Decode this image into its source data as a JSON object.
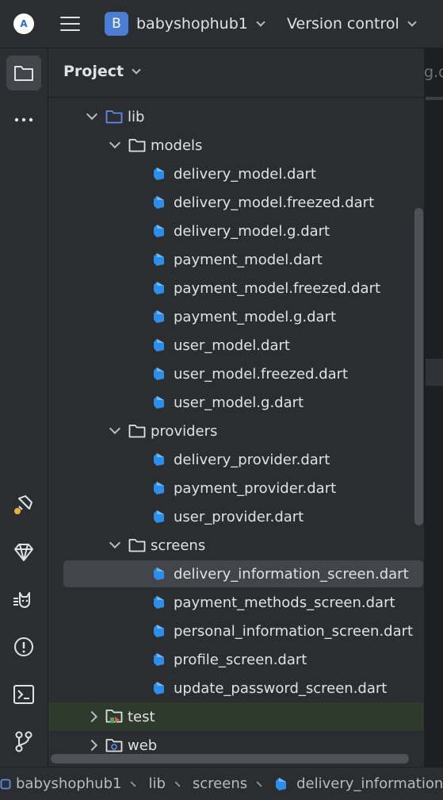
{
  "titlebar": {
    "project_badge": "B",
    "project_name": "babyshophub1",
    "vcs_label": "Version control"
  },
  "panel": {
    "title": "Project"
  },
  "editor": {
    "tab_fragment": "g.d"
  },
  "tree": [
    {
      "label": "lib",
      "type": "folder-src",
      "level": 0,
      "expanded": true
    },
    {
      "label": "models",
      "type": "folder",
      "level": 1,
      "expanded": true
    },
    {
      "label": "delivery_model.dart",
      "type": "dart",
      "level": 2
    },
    {
      "label": "delivery_model.freezed.dart",
      "type": "dart",
      "level": 2
    },
    {
      "label": "delivery_model.g.dart",
      "type": "dart",
      "level": 2
    },
    {
      "label": "payment_model.dart",
      "type": "dart",
      "level": 2
    },
    {
      "label": "payment_model.freezed.dart",
      "type": "dart",
      "level": 2
    },
    {
      "label": "payment_model.g.dart",
      "type": "dart",
      "level": 2
    },
    {
      "label": "user_model.dart",
      "type": "dart",
      "level": 2
    },
    {
      "label": "user_model.freezed.dart",
      "type": "dart",
      "level": 2
    },
    {
      "label": "user_model.g.dart",
      "type": "dart",
      "level": 2
    },
    {
      "label": "providers",
      "type": "folder",
      "level": 1,
      "expanded": true
    },
    {
      "label": "delivery_provider.dart",
      "type": "dart",
      "level": 2
    },
    {
      "label": "payment_provider.dart",
      "type": "dart",
      "level": 2
    },
    {
      "label": "user_provider.dart",
      "type": "dart",
      "level": 2
    },
    {
      "label": "screens",
      "type": "folder",
      "level": 1,
      "expanded": true
    },
    {
      "label": "delivery_information_screen.dart",
      "type": "dart",
      "level": 2,
      "selected": true
    },
    {
      "label": "payment_methods_screen.dart",
      "type": "dart",
      "level": 2
    },
    {
      "label": "personal_information_screen.dart",
      "type": "dart",
      "level": 2
    },
    {
      "label": "profile_screen.dart",
      "type": "dart",
      "level": 2
    },
    {
      "label": "update_password_screen.dart",
      "type": "dart",
      "level": 2
    },
    {
      "label": "test",
      "type": "folder-test",
      "level": 0,
      "expanded": false,
      "vcs_added": true
    },
    {
      "label": "web",
      "type": "folder-web",
      "level": 0,
      "expanded": false
    }
  ],
  "breadcrumbs": {
    "project": "babyshophub1",
    "dir1": "lib",
    "dir2": "screens",
    "file": "delivery_information_screen.dart"
  },
  "activity_icons": [
    "project-folder-icon",
    "more-icon",
    "flutter-inspector-icon",
    "ruby-gem-icon",
    "cat-icon",
    "problems-icon",
    "terminal-icon",
    "git-icon"
  ],
  "colors": {
    "accent_blue": "#4a7dd4",
    "dart_blue": "#2d8ee9",
    "selection": "#43454a",
    "vcs_added_row": "#2e3a2b"
  }
}
